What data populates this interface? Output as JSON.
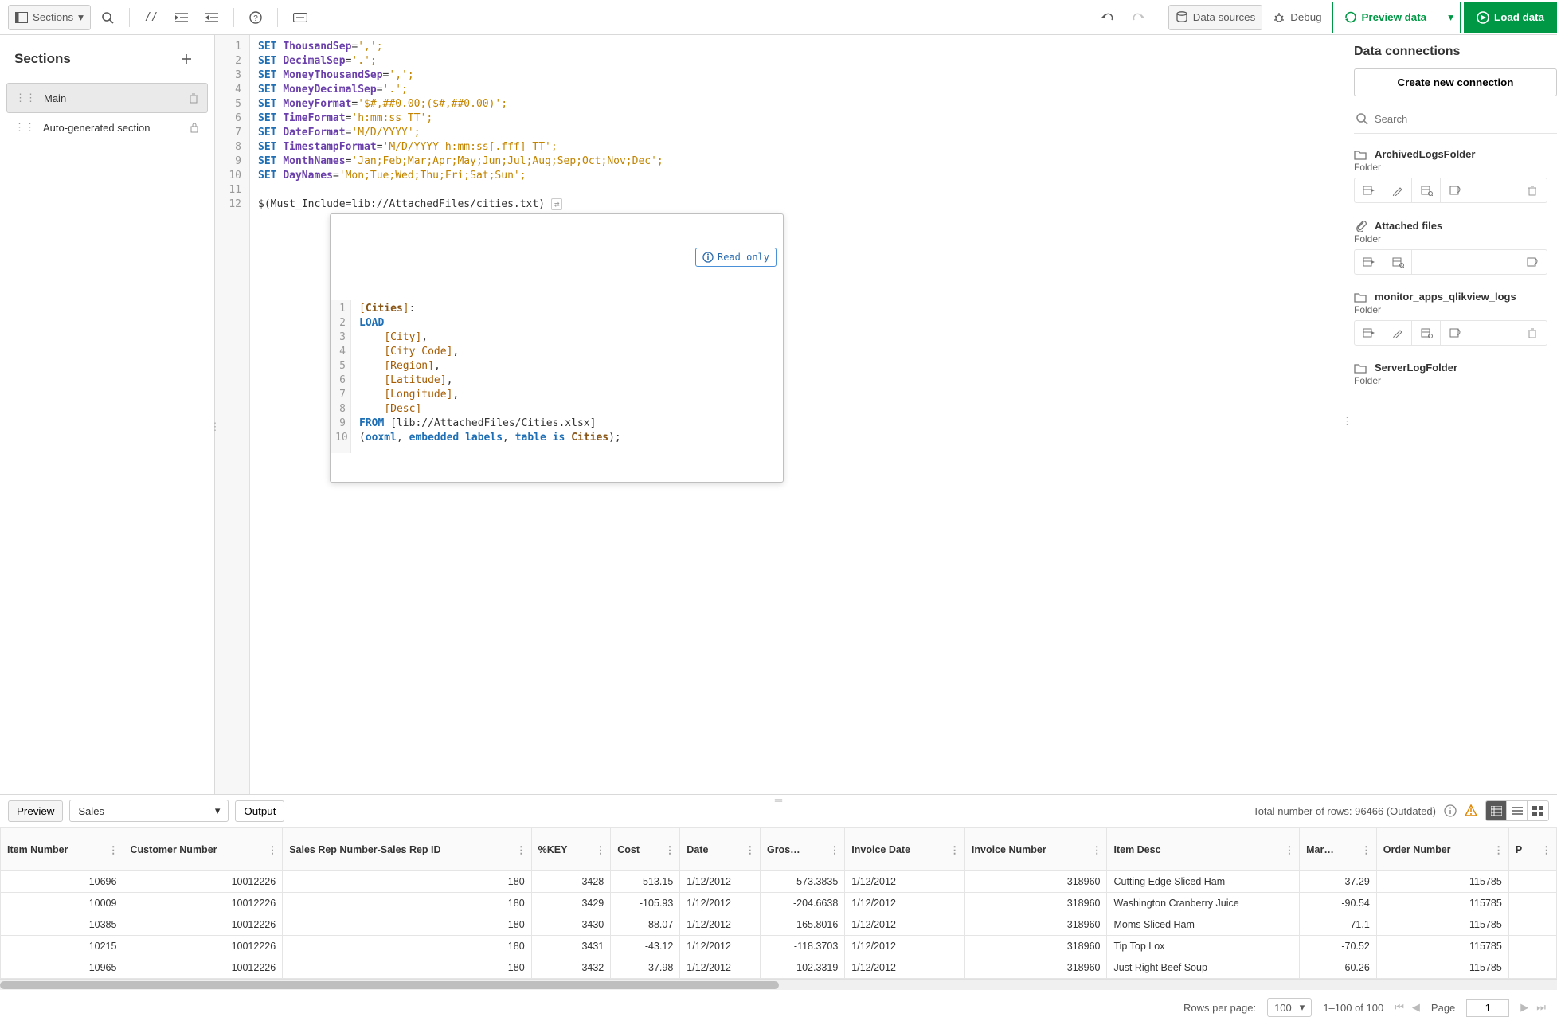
{
  "toolbar": {
    "sections_btn": "Sections",
    "data_sources_btn": "Data sources",
    "debug_btn": "Debug",
    "preview_btn": "Preview data",
    "load_btn": "Load data"
  },
  "sections": {
    "title": "Sections",
    "items": [
      {
        "label": "Main",
        "active": true,
        "locked": false
      },
      {
        "label": "Auto-generated section",
        "active": false,
        "locked": true
      }
    ]
  },
  "editor": {
    "lines": [
      "1",
      "2",
      "3",
      "4",
      "5",
      "6",
      "7",
      "8",
      "9",
      "10",
      "11",
      "12"
    ],
    "script": [
      {
        "kw": "SET",
        "var": "ThousandSep",
        "rest": "=',';"
      },
      {
        "kw": "SET",
        "var": "DecimalSep",
        "rest": "='.';"
      },
      {
        "kw": "SET",
        "var": "MoneyThousandSep",
        "rest": "=',';"
      },
      {
        "kw": "SET",
        "var": "MoneyDecimalSep",
        "rest": "='.';"
      },
      {
        "kw": "SET",
        "var": "MoneyFormat",
        "rest": "='$#,##0.00;($#,##0.00)';"
      },
      {
        "kw": "SET",
        "var": "TimeFormat",
        "rest": "='h:mm:ss TT';"
      },
      {
        "kw": "SET",
        "var": "DateFormat",
        "rest": "='M/D/YYYY';"
      },
      {
        "kw": "SET",
        "var": "TimestampFormat",
        "rest": "='M/D/YYYY h:mm:ss[.fff] TT';"
      },
      {
        "kw": "SET",
        "var": "MonthNames",
        "rest": "='Jan;Feb;Mar;Apr;May;Jun;Jul;Aug;Sep;Oct;Nov;Dec';"
      },
      {
        "kw": "SET",
        "var": "DayNames",
        "rest": "='Mon;Tue;Wed;Thu;Fri;Sat;Sun';"
      }
    ],
    "include_line": "$(Must_Include=lib://AttachedFiles/cities.txt)"
  },
  "inset": {
    "readonly": "Read only",
    "lines": [
      "1",
      "2",
      "3",
      "4",
      "5",
      "6",
      "7",
      "8",
      "9",
      "10"
    ],
    "table": "Cities",
    "load": "LOAD",
    "fields": [
      "[City]",
      "[City Code]",
      "[Region]",
      "[Latitude]",
      "[Longitude]",
      "[Desc]"
    ],
    "from": "FROM",
    "from_path": "[lib://AttachedFiles/Cities.xlsx]",
    "spec_a": "ooxml",
    "spec_b": "embedded labels",
    "spec_c": "table is",
    "spec_tbl": "Cities"
  },
  "connections": {
    "title": "Data connections",
    "create_btn": "Create new connection",
    "search_placeholder": "Search",
    "items": [
      {
        "name": "ArchivedLogsFolder",
        "type": "Folder",
        "icon": "folder",
        "actions": [
          "insert",
          "edit",
          "select",
          "unlink",
          "delete"
        ]
      },
      {
        "name": "Attached files",
        "type": "Folder",
        "icon": "attach",
        "actions": [
          "insert",
          "select",
          "unlink"
        ]
      },
      {
        "name": "monitor_apps_qlikview_logs",
        "type": "Folder",
        "icon": "folder",
        "actions": [
          "insert",
          "edit",
          "select",
          "unlink",
          "delete"
        ]
      },
      {
        "name": "ServerLogFolder",
        "type": "Folder",
        "icon": "folder",
        "actions": []
      }
    ]
  },
  "preview": {
    "tab_preview": "Preview",
    "tab_output": "Output",
    "select_value": "Sales",
    "rows_text": "Total number of rows: 96466 (Outdated)",
    "columns": [
      "Item Number",
      "Customer Number",
      "Sales Rep Number-Sales Rep ID",
      "%KEY",
      "Cost",
      "Date",
      "Gros…",
      "Invoice Date",
      "Invoice Number",
      "Item Desc",
      "Mar…",
      "Order Number",
      "P"
    ],
    "rows": [
      [
        "10696",
        "10012226",
        "180",
        "3428",
        "-513.15",
        "1/12/2012",
        "-573.3835",
        "1/12/2012",
        "318960",
        "Cutting Edge Sliced Ham",
        "-37.29",
        "115785"
      ],
      [
        "10009",
        "10012226",
        "180",
        "3429",
        "-105.93",
        "1/12/2012",
        "-204.6638",
        "1/12/2012",
        "318960",
        "Washington Cranberry Juice",
        "-90.54",
        "115785"
      ],
      [
        "10385",
        "10012226",
        "180",
        "3430",
        "-88.07",
        "1/12/2012",
        "-165.8016",
        "1/12/2012",
        "318960",
        "Moms Sliced Ham",
        "-71.1",
        "115785"
      ],
      [
        "10215",
        "10012226",
        "180",
        "3431",
        "-43.12",
        "1/12/2012",
        "-118.3703",
        "1/12/2012",
        "318960",
        "Tip Top Lox",
        "-70.52",
        "115785"
      ],
      [
        "10965",
        "10012226",
        "180",
        "3432",
        "-37.98",
        "1/12/2012",
        "-102.3319",
        "1/12/2012",
        "318960",
        "Just Right Beef Soup",
        "-60.26",
        "115785"
      ]
    ]
  },
  "pager": {
    "rows_per_page_label": "Rows per page:",
    "rows_per_page_value": "100",
    "range": "1–100 of 100",
    "page_label": "Page",
    "page_value": "1"
  }
}
